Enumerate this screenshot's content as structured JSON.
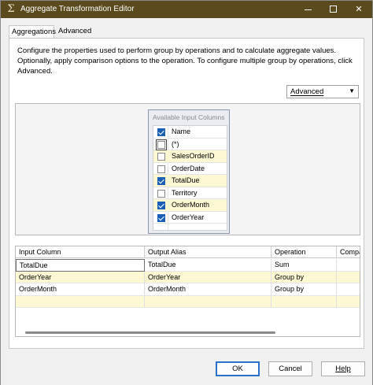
{
  "window": {
    "title": "Aggregate Transformation Editor",
    "app_icon": "sigma-icon",
    "controls": {
      "minimize": "minimize-icon",
      "maximize": "maximize-icon",
      "close": "close-icon"
    }
  },
  "tabs": [
    {
      "label": "Aggregations",
      "active": true
    },
    {
      "label": "Advanced",
      "active": false
    }
  ],
  "description": "Configure the properties used to perform group by operations and to calculate aggregate values. Optionally, apply comparison options to the operation. To configure multiple group by operations, click Advanced.",
  "mode_dropdown": {
    "value": "Advanced"
  },
  "available_columns": {
    "title": "Available Input Columns",
    "header": {
      "label": "Name",
      "checked": true
    },
    "items": [
      {
        "label": "(*)",
        "checked": false,
        "highlight": false
      },
      {
        "label": "SalesOrderID",
        "checked": false,
        "highlight": true
      },
      {
        "label": "OrderDate",
        "checked": false,
        "highlight": false
      },
      {
        "label": "TotalDue",
        "checked": true,
        "highlight": true
      },
      {
        "label": "Territory",
        "checked": false,
        "highlight": false
      },
      {
        "label": "OrderMonth",
        "checked": true,
        "highlight": true
      },
      {
        "label": "OrderYear",
        "checked": true,
        "highlight": false
      }
    ]
  },
  "grid": {
    "headers": [
      "Input Column",
      "Output Alias",
      "Operation",
      "Compa"
    ],
    "rows": [
      {
        "input": "TotalDue",
        "alias": "TotalDue",
        "operation": "Sum",
        "comparison": ""
      },
      {
        "input": "OrderYear",
        "alias": "OrderYear",
        "operation": "Group by",
        "comparison": ""
      },
      {
        "input": "OrderMonth",
        "alias": "OrderMonth",
        "operation": "Group by",
        "comparison": ""
      },
      {
        "input": "",
        "alias": "",
        "operation": "",
        "comparison": ""
      }
    ]
  },
  "buttons": {
    "ok": "OK",
    "cancel": "Cancel",
    "help": "Help"
  },
  "colors": {
    "titlebar": "#5b4a1d",
    "highlight_row": "#fcf8d4",
    "checkbox": "#1a5fb4"
  }
}
